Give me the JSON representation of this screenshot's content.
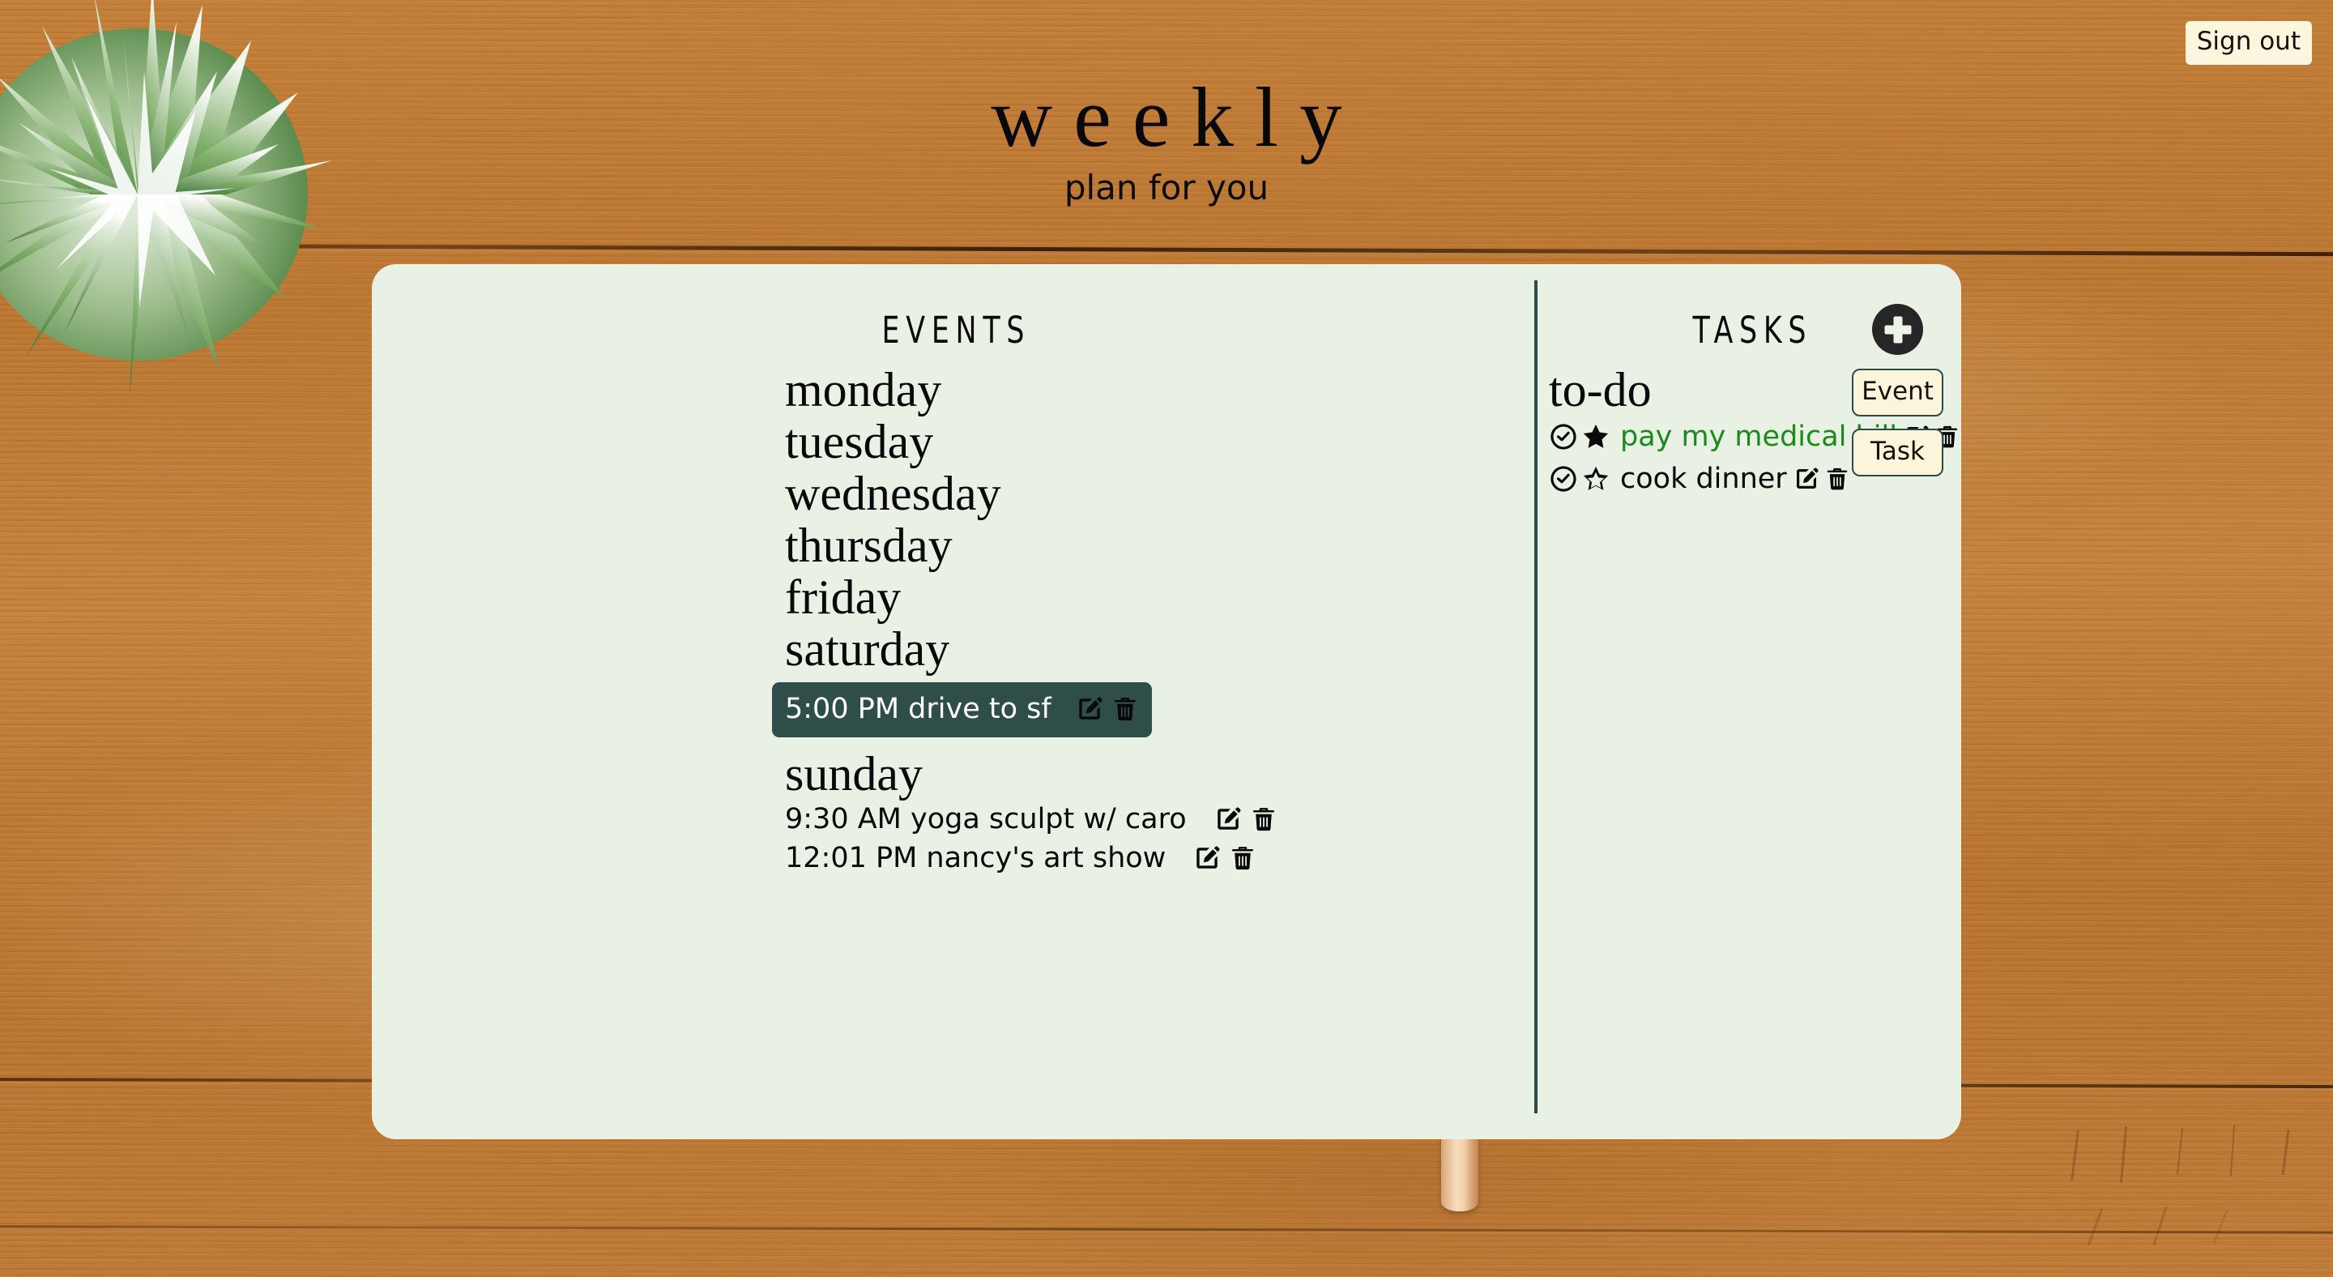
{
  "header": {
    "title": "weekly",
    "subtitle": "plan for you",
    "signout_label": "Sign out"
  },
  "colors": {
    "panel_bg": "#E9F0E4",
    "accent_dark": "#2C4B48",
    "highlight_bg": "#2F4D49",
    "button_cream": "#FBF5DC",
    "priority_green": "#1A8A1C",
    "desk_wood": "#C4803B"
  },
  "events": {
    "heading": "EVENTS",
    "days": [
      {
        "name": "monday",
        "events": []
      },
      {
        "name": "tuesday",
        "events": []
      },
      {
        "name": "wednesday",
        "events": []
      },
      {
        "name": "thursday",
        "events": []
      },
      {
        "name": "friday",
        "events": []
      },
      {
        "name": "saturday",
        "events": [
          {
            "text": "5:00 PM drive to sf",
            "highlighted": true
          }
        ]
      },
      {
        "name": "sunday",
        "events": [
          {
            "text": "9:30 AM yoga sculpt w/ caro",
            "highlighted": false
          },
          {
            "text": "12:01 PM nancy's art show",
            "highlighted": false
          }
        ]
      }
    ]
  },
  "tasks": {
    "heading": "TASKS",
    "list_title": "to-do",
    "items": [
      {
        "text": "pay my medical bill",
        "starred": true,
        "completed": false
      },
      {
        "text": "cook dinner",
        "starred": false,
        "completed": false
      }
    ]
  },
  "add_controls": {
    "add_label": "+",
    "options": [
      {
        "label": "Event"
      },
      {
        "label": "Task"
      }
    ]
  },
  "icons": {
    "edit": "edit-icon",
    "delete": "trash-icon",
    "check": "check-circle-icon",
    "star_filled": "star-filled-icon",
    "star_outline": "star-outline-icon"
  }
}
